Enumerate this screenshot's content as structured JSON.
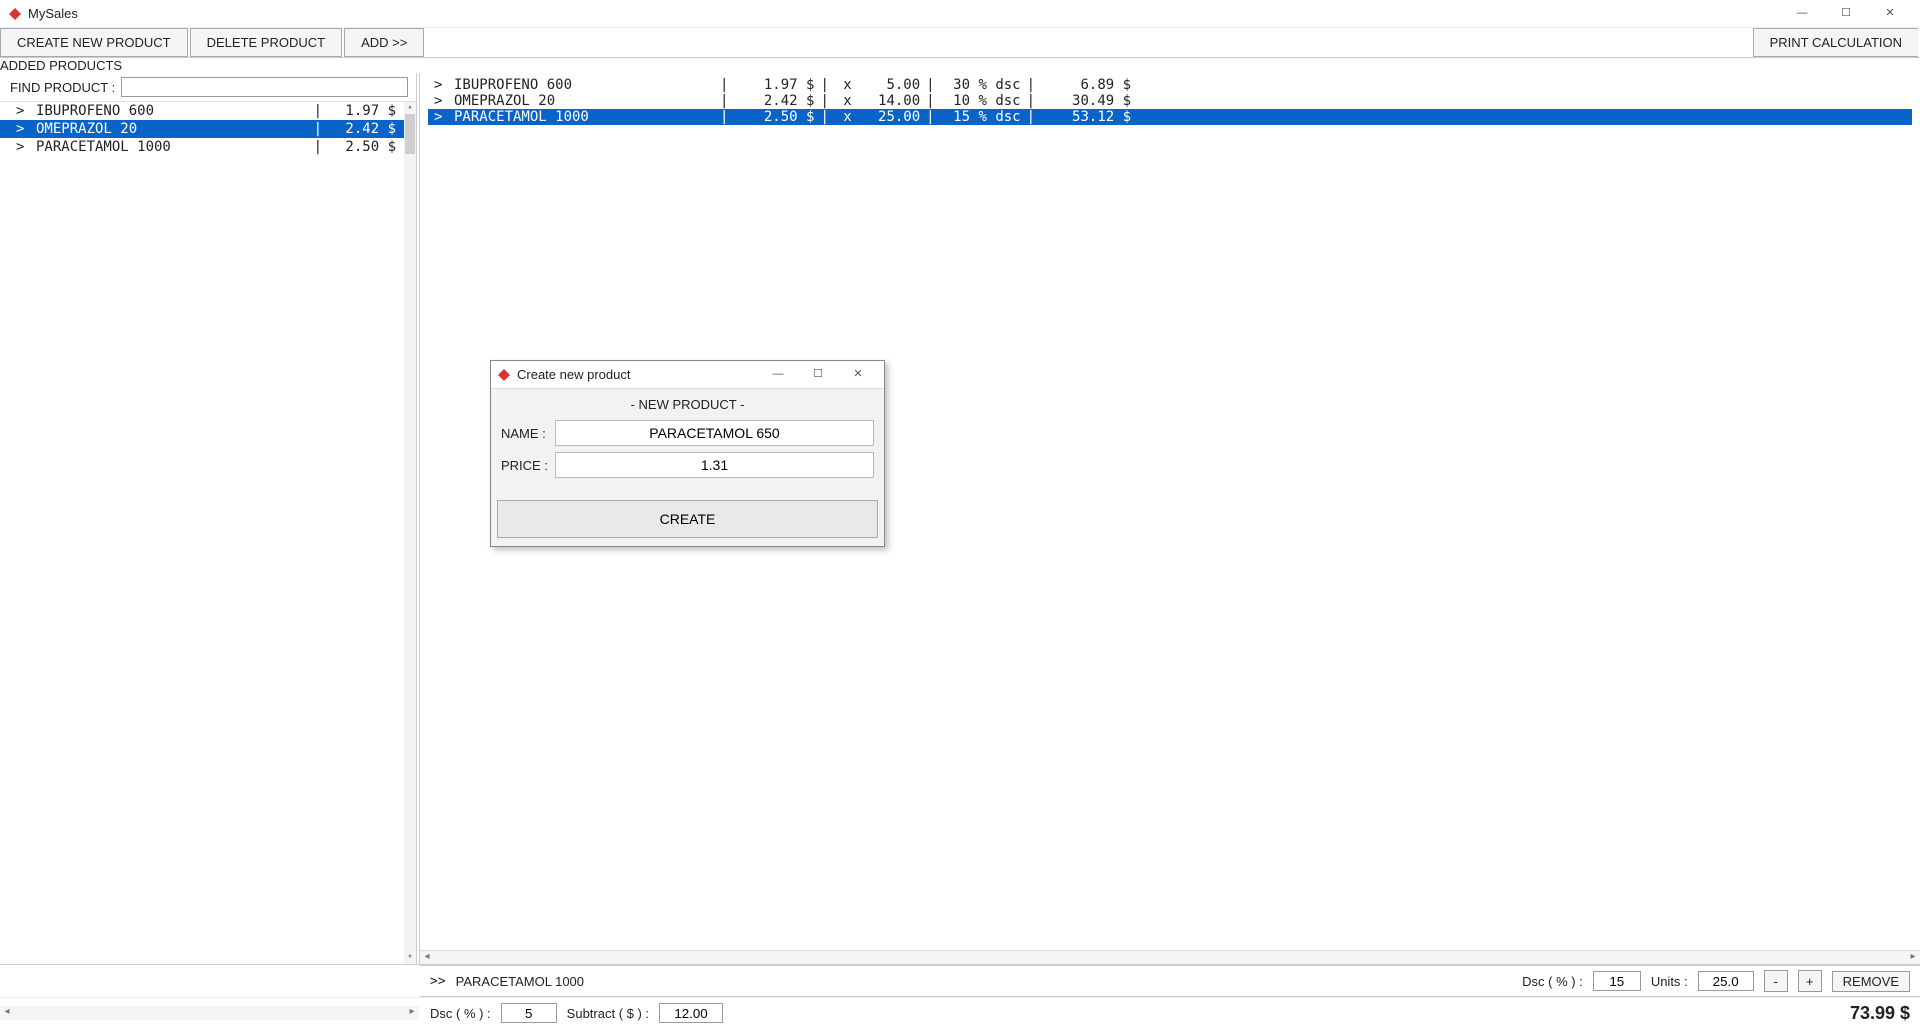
{
  "app": {
    "title": "MySales"
  },
  "toolbar": {
    "create": "CREATE NEW PRODUCT",
    "delete": "DELETE PRODUCT",
    "add": "ADD   >>",
    "center": "ADDED PRODUCTS",
    "print": "PRINT CALCULATION"
  },
  "find": {
    "label": "FIND PRODUCT :",
    "value": ""
  },
  "products": [
    {
      "name": "IBUPROFENO 600",
      "price": "1.97 $",
      "selected": false
    },
    {
      "name": "OMEPRAZOL 20",
      "price": "2.42 $",
      "selected": true
    },
    {
      "name": "PARACETAMOL 1000",
      "price": "2.50 $",
      "selected": false
    }
  ],
  "added": [
    {
      "name": "IBUPROFENO 600",
      "price": "1.97 $",
      "qty": "5.00",
      "dsc": "30 % dsc",
      "total": "6.89 $",
      "selected": false
    },
    {
      "name": "OMEPRAZOL 20",
      "price": "2.42 $",
      "qty": "14.00",
      "dsc": "10 % dsc",
      "total": "30.49 $",
      "selected": false
    },
    {
      "name": "PARACETAMOL 1000",
      "price": "2.50 $",
      "qty": "25.00",
      "dsc": "15 % dsc",
      "total": "53.12 $",
      "selected": true
    }
  ],
  "selbar": {
    "marker": ">>",
    "name": "PARACETAMOL 1000",
    "dsc_label": "Dsc ( % ) :",
    "dsc_value": "15",
    "units_label": "Units :",
    "units_value": "25.0",
    "minus": "-",
    "plus": "+",
    "remove": "REMOVE"
  },
  "totals": {
    "dsc_label": "Dsc ( % ) :",
    "dsc_value": "5",
    "sub_label": "Subtract ( $ ) :",
    "sub_value": "12.00",
    "grand": "73.99 $"
  },
  "modal": {
    "title": "Create new product",
    "heading": "- NEW PRODUCT -",
    "name_label": "NAME :",
    "name_value": "PARACETAMOL 650",
    "price_label": "PRICE :",
    "price_value": "1.31",
    "create": "CREATE"
  }
}
